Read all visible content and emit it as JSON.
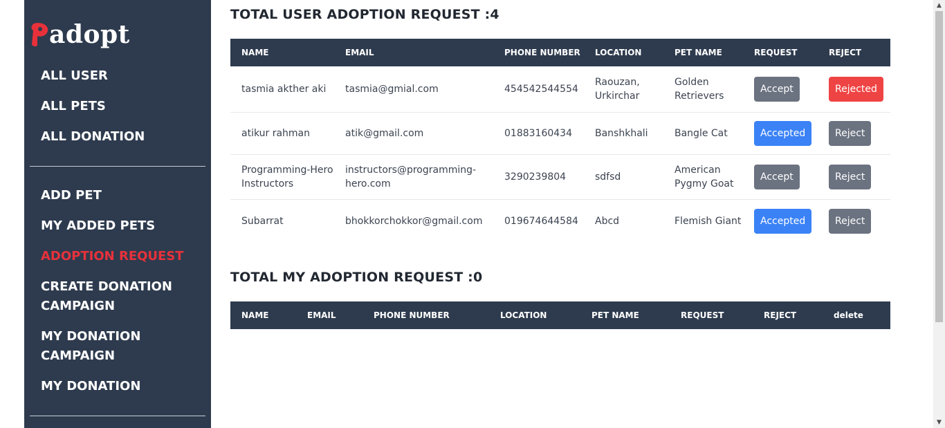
{
  "brand": {
    "logo_text": "adopt",
    "logo_initial": "P",
    "logo_color": "#e8313b"
  },
  "sidebar": {
    "background": "#2e3b4e",
    "items_top": [
      {
        "label": "ALL USER"
      },
      {
        "label": "ALL PETS"
      },
      {
        "label": "ALL DONATION"
      }
    ],
    "items_bottom": [
      {
        "label": "ADD PET"
      },
      {
        "label": "MY ADDED PETS"
      },
      {
        "label": "ADOPTION REQUEST",
        "active": true
      },
      {
        "label": "CREATE DONATION CAMPAIGN"
      },
      {
        "label": "MY DONATION CAMPAIGN"
      },
      {
        "label": "MY DONATION"
      }
    ]
  },
  "user_requests": {
    "title": "TOTAL USER ADOPTION REQUEST :4",
    "columns": [
      "NAME",
      "EMAIL",
      "PHONE NUMBER",
      "LOCATION",
      "PET NAME",
      "REQUEST",
      "REJECT"
    ],
    "rows": [
      {
        "name": "tasmia akther aki",
        "email": "tasmia@gmial.com",
        "phone": "454542544554",
        "location": "Raouzan, Urkirchar",
        "pet": "Golden Retrievers",
        "request": "Accept",
        "reject": "Rejected"
      },
      {
        "name": "atikur rahman",
        "email": "atik@gmail.com",
        "phone": "01883160434",
        "location": "Banshkhali",
        "pet": "Bangle Cat",
        "request": "Accepted",
        "reject": "Reject"
      },
      {
        "name": "Programming-Hero Instructors",
        "email": "instructors@programming-hero.com",
        "phone": "3290239804",
        "location": "sdfsd",
        "pet": "American Pygmy Goat",
        "request": "Accept",
        "reject": "Reject"
      },
      {
        "name": "Subarrat",
        "email": "bhokkorchokkor@gmail.com",
        "phone": "019674644584",
        "location": "Abcd",
        "pet": "Flemish Giant",
        "request": "Accepted",
        "reject": "Reject"
      }
    ]
  },
  "my_requests": {
    "title": "TOTAL MY ADOPTION REQUEST :0",
    "columns": [
      "NAME",
      "EMAIL",
      "PHONE NUMBER",
      "LOCATION",
      "PET NAME",
      "REQUEST",
      "REJECT",
      "delete"
    ],
    "rows": []
  },
  "colors": {
    "accent_blue": "#3b82f6",
    "gray_button": "#6b7280",
    "reject_red": "#ef4444",
    "header_bg": "#2e3b4e"
  }
}
